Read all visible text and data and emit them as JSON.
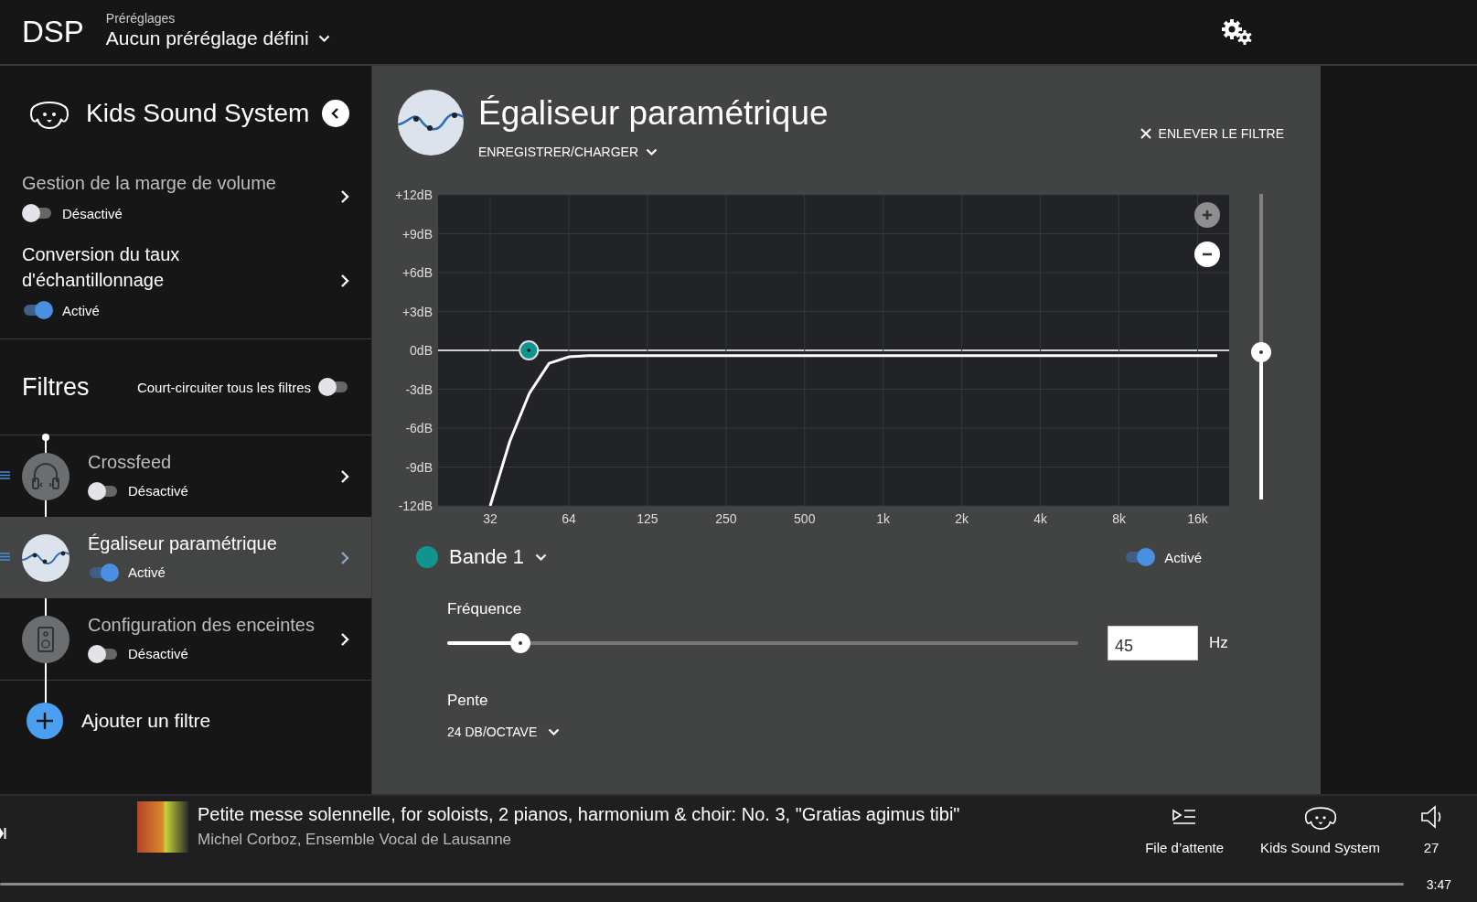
{
  "header": {
    "app_title": "DSP",
    "presets_label": "Préréglages",
    "preset_value": "Aucun préréglage défini"
  },
  "sidebar": {
    "device_name": "Kids Sound System",
    "settings": [
      {
        "title": "Gestion de la marge de volume",
        "status": "Désactivé",
        "on": false
      },
      {
        "title": "Conversion du taux d'échantillonnage",
        "status": "Activé",
        "on": true
      }
    ],
    "filters_heading": "Filtres",
    "bypass_label": "Court-circuiter tous les filtres",
    "bypass_on": false,
    "filters": [
      {
        "kind": "crossfeed",
        "title": "Crossfeed",
        "status": "Désactivé",
        "on": false,
        "selected": false,
        "drag_handle": true
      },
      {
        "kind": "equalizer",
        "title": "Égaliseur paramétrique",
        "status": "Activé",
        "on": true,
        "selected": true,
        "drag_handle": true
      },
      {
        "kind": "speakers",
        "title": "Configuration des enceintes",
        "status": "Désactivé",
        "on": false,
        "selected": false,
        "drag_handle": false
      }
    ],
    "add_filter": "Ajouter un filtre"
  },
  "panel": {
    "title": "Égaliseur paramétrique",
    "save_load": "ENREGISTRER/CHARGER",
    "remove": "ENLEVER LE FILTRE",
    "chart_data": {
      "type": "line",
      "categories": [
        null,
        null,
        "32",
        null,
        null,
        null,
        "64",
        null,
        null,
        null,
        "125",
        null,
        null,
        null,
        "250",
        null,
        null,
        null,
        "500",
        null,
        null,
        null,
        "1k",
        null,
        null,
        null,
        "2k",
        null,
        null,
        null,
        "4k",
        null,
        null,
        null,
        "8k",
        null,
        null,
        null,
        "16k",
        null
      ],
      "series": [
        {
          "color": "#ffffff",
          "values": [
            null,
            null,
            -12,
            -7,
            -3.3,
            -1,
            -0.5,
            -0.4,
            -0.4,
            -0.4,
            -0.4,
            -0.4,
            -0.4,
            -0.4,
            -0.4,
            -0.4,
            -0.4,
            -0.4,
            -0.4,
            -0.4,
            -0.4,
            -0.4,
            -0.4,
            -0.4,
            -0.4,
            -0.4,
            -0.4,
            -0.4,
            -0.4,
            -0.4,
            -0.4,
            -0.4,
            -0.4,
            -0.4,
            -0.4,
            -0.4,
            -0.4,
            -0.4,
            -0.4,
            -0.4
          ]
        }
      ],
      "ylim": [
        -12,
        12
      ],
      "grid": true,
      "yticks": [
        {
          "value": 12,
          "label": "+12dB"
        },
        {
          "value": 9,
          "label": "+9dB"
        },
        {
          "value": 6,
          "label": "+6dB"
        },
        {
          "value": 3,
          "label": "+3dB"
        },
        {
          "value": 0,
          "label": "0dB"
        },
        {
          "value": -3,
          "label": "-3dB"
        },
        {
          "value": -6,
          "label": "-6dB"
        },
        {
          "value": -9,
          "label": "-9dB"
        },
        {
          "value": -12,
          "label": "-12dB"
        }
      ]
    },
    "gain_slider": {
      "level": 0.5
    },
    "band": {
      "label": "Bande 1",
      "color": "#0f9490",
      "status": "Activé",
      "on": true,
      "frequency_label": "Fréquence",
      "frequency_slider": {
        "level": 0.116
      },
      "frequency_value": "45",
      "frequency_unit": "Hz",
      "slope_label": "Pente",
      "slope_value": "24 DB/OCTAVE"
    }
  },
  "player": {
    "track_title": "Petite messe solennelle, for soloists, 2 pianos, harmonium & choir: No. 3, \"Gratias agimus tibi\"",
    "artist": "Michel Corboz, Ensemble Vocal de Lausanne",
    "queue_label": "File d’attente",
    "device_label": "Kids Sound System",
    "volume": "27",
    "time": "3:47",
    "progress": {
      "level": 1
    }
  }
}
